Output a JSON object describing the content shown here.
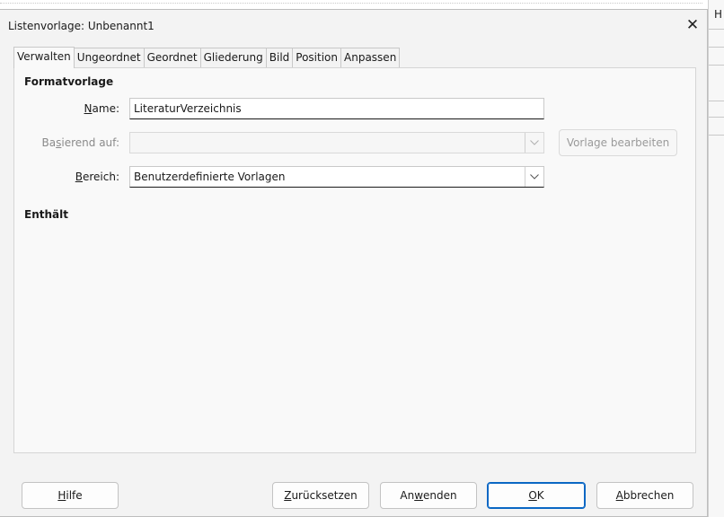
{
  "window": {
    "title": "Listenvorlage: Unbenannt1",
    "close_glyph": "✕",
    "background_panel_letter": "H"
  },
  "tabs": [
    {
      "label": "Verwalten",
      "active": true
    },
    {
      "label": "Ungeordnet"
    },
    {
      "label": "Geordnet"
    },
    {
      "label": "Gliederung"
    },
    {
      "label": "Bild"
    },
    {
      "label": "Position"
    },
    {
      "label": "Anpassen"
    }
  ],
  "section_format": "Formatvorlage",
  "name": {
    "label_pre": "",
    "label_mn": "N",
    "label_post": "ame:",
    "value": "LiteraturVerzeichnis"
  },
  "based_on": {
    "label_pre": "Ba",
    "label_mn": "s",
    "label_post": "ierend auf:",
    "value": "",
    "edit_button": "Vorlage bearbeiten"
  },
  "area": {
    "label_pre": "",
    "label_mn": "B",
    "label_post": "ereich:",
    "value": "Benutzerdefinierte Vorlagen"
  },
  "section_contains": "Enthält",
  "buttons": {
    "help": {
      "pre": "",
      "mn": "H",
      "post": "ilfe"
    },
    "reset": {
      "pre": "",
      "mn": "Z",
      "post": "urücksetzen"
    },
    "apply": {
      "pre": "An",
      "mn": "w",
      "post": "enden"
    },
    "ok": {
      "pre": "",
      "mn": "O",
      "post": "K"
    },
    "cancel": {
      "pre": "",
      "mn": "A",
      "post": "bbrechen"
    }
  },
  "colors": {
    "accent": "#0a67c4",
    "disabled_text": "#8a8a8a"
  }
}
